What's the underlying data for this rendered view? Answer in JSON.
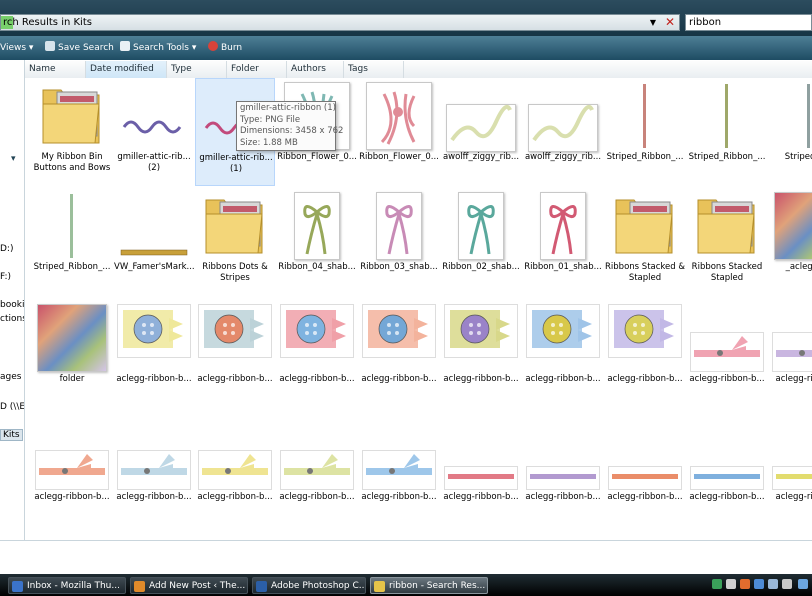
{
  "address": {
    "path_text": "rch Results in Kits"
  },
  "search": {
    "query": "ribbon"
  },
  "toolbar": {
    "views": "Views",
    "save_search": "Save Search",
    "search_tools": "Search Tools",
    "burn": "Burn"
  },
  "columns": [
    "Name",
    "Date modified",
    "Type",
    "Folder",
    "Authors",
    "Tags"
  ],
  "leftnav": {
    "d": "D:)",
    "f": "F:)",
    "booking": "bookin",
    "ctions": "ctions,",
    "ages": "ages",
    "network": "D (\\\\EF",
    "kits": "Kits"
  },
  "tooltip": {
    "line1": "gmiller-attic-ribbon (1)",
    "line2": "Type: PNG File",
    "line3": "Dimensions: 3458 x 762",
    "line4": "Size: 1.88 MB"
  },
  "items": [
    {
      "label": "My Ribbon Bin Buttons and Bows",
      "kind": "folder"
    },
    {
      "label": "gmiller-attic-rib... (2)",
      "kind": "wave",
      "color": "#6b5fa8"
    },
    {
      "label": "gmiller-attic-rib... (1)",
      "kind": "wave",
      "color": "#c24a7c",
      "selected": true
    },
    {
      "label": "Ribbon_Flower_0...",
      "kind": "flower",
      "color": "#7fb8b3"
    },
    {
      "label": "Ribbon_Flower_0...",
      "kind": "flower",
      "color": "#e08b96"
    },
    {
      "label": "awolff_ziggy_rib...",
      "kind": "ziggy",
      "color": "#d9dfae"
    },
    {
      "label": "awolff_ziggy_rib...",
      "kind": "ziggy",
      "color": "#d9dfae"
    },
    {
      "label": "Striped_Ribbon_...",
      "kind": "vstripe",
      "color": "#c8837b"
    },
    {
      "label": "Striped_Ribbon_...",
      "kind": "vstripe",
      "color": "#9fa86a"
    },
    {
      "label": "Striped_Rib",
      "kind": "vstripe",
      "color": "#8fa0a0"
    },
    {
      "label": "Striped_Ribbon_...",
      "kind": "vstripe",
      "color": "#9bbf9b"
    },
    {
      "label": "VW_Famer'sMark...",
      "kind": "hstrip",
      "color": "#c8a03a"
    },
    {
      "label": "Ribbons Dots & Stripes",
      "kind": "folder"
    },
    {
      "label": "Ribbon_04_shab...",
      "kind": "bow",
      "color": "#97a85a"
    },
    {
      "label": "Ribbon_03_shab...",
      "kind": "bow",
      "color": "#c88bb6"
    },
    {
      "label": "Ribbon_02_shab...",
      "kind": "bow",
      "color": "#5aa89c"
    },
    {
      "label": "Ribbon_01_shab...",
      "kind": "bow",
      "color": "#d25a73"
    },
    {
      "label": "Ribbons Stacked & Stapled",
      "kind": "folder"
    },
    {
      "label": "Ribbons Stacked Stapled",
      "kind": "folder"
    },
    {
      "label": "_aclegg-rib",
      "kind": "collage"
    },
    {
      "label": "folder",
      "kind": "collage"
    },
    {
      "label": "aclegg-ribbon-b...",
      "kind": "button",
      "color": "#efe89a",
      "btn": "#8fb0d9"
    },
    {
      "label": "aclegg-ribbon-b...",
      "kind": "button",
      "color": "#bcd2d8",
      "btn": "#e4896a"
    },
    {
      "label": "aclegg-ribbon-b...",
      "kind": "button",
      "color": "#f0a0a8",
      "btn": "#7fb3e0"
    },
    {
      "label": "aclegg-ribbon-b...",
      "kind": "button",
      "color": "#f3b39c",
      "btn": "#74a7d6"
    },
    {
      "label": "aclegg-ribbon-b...",
      "kind": "button",
      "color": "#d8d88a",
      "btn": "#9a83c8"
    },
    {
      "label": "aclegg-ribbon-b...",
      "kind": "button",
      "color": "#9fc4e8",
      "btn": "#d8c84a"
    },
    {
      "label": "aclegg-ribbon-b...",
      "kind": "button",
      "color": "#c2b8e6",
      "btn": "#d8cf5c"
    },
    {
      "label": "aclegg-ribbon-b...",
      "kind": "tiedstrip",
      "color": "#f0a3b2"
    },
    {
      "label": "aclegg-ribbon-b",
      "kind": "tiedstrip",
      "color": "#c9b6e0"
    },
    {
      "label": "aclegg-ribbon-b...",
      "kind": "tiedstrip",
      "color": "#f0a88f"
    },
    {
      "label": "aclegg-ribbon-b...",
      "kind": "tiedstrip",
      "color": "#bfd8e6"
    },
    {
      "label": "aclegg-ribbon-b...",
      "kind": "tiedstrip",
      "color": "#efe492"
    },
    {
      "label": "aclegg-ribbon-b...",
      "kind": "tiedstrip",
      "color": "#dde3a3"
    },
    {
      "label": "aclegg-ribbon-b...",
      "kind": "tiedstrip",
      "color": "#9ec7ea"
    },
    {
      "label": "aclegg-ribbon-b...",
      "kind": "thinstrip",
      "color": "#e27a86"
    },
    {
      "label": "aclegg-ribbon-b...",
      "kind": "thinstrip",
      "color": "#b29ad0"
    },
    {
      "label": "aclegg-ribbon-b...",
      "kind": "thinstrip",
      "color": "#ea8d69"
    },
    {
      "label": "aclegg-ribbon-b...",
      "kind": "thinstrip",
      "color": "#7fb0de"
    },
    {
      "label": "aclegg-ribbon-b",
      "kind": "thinstrip",
      "color": "#e2dc6e"
    }
  ],
  "taskbar": [
    {
      "label": "Inbox - Mozilla Thu...",
      "color": "#3b73c9"
    },
    {
      "label": "Add New Post ‹ The...",
      "color": "#e08a2a"
    },
    {
      "label": "Adobe Photoshop C...",
      "color": "#2b5fa8"
    },
    {
      "label": "ribbon - Search Res...",
      "color": "#e6c449",
      "active": true
    }
  ]
}
